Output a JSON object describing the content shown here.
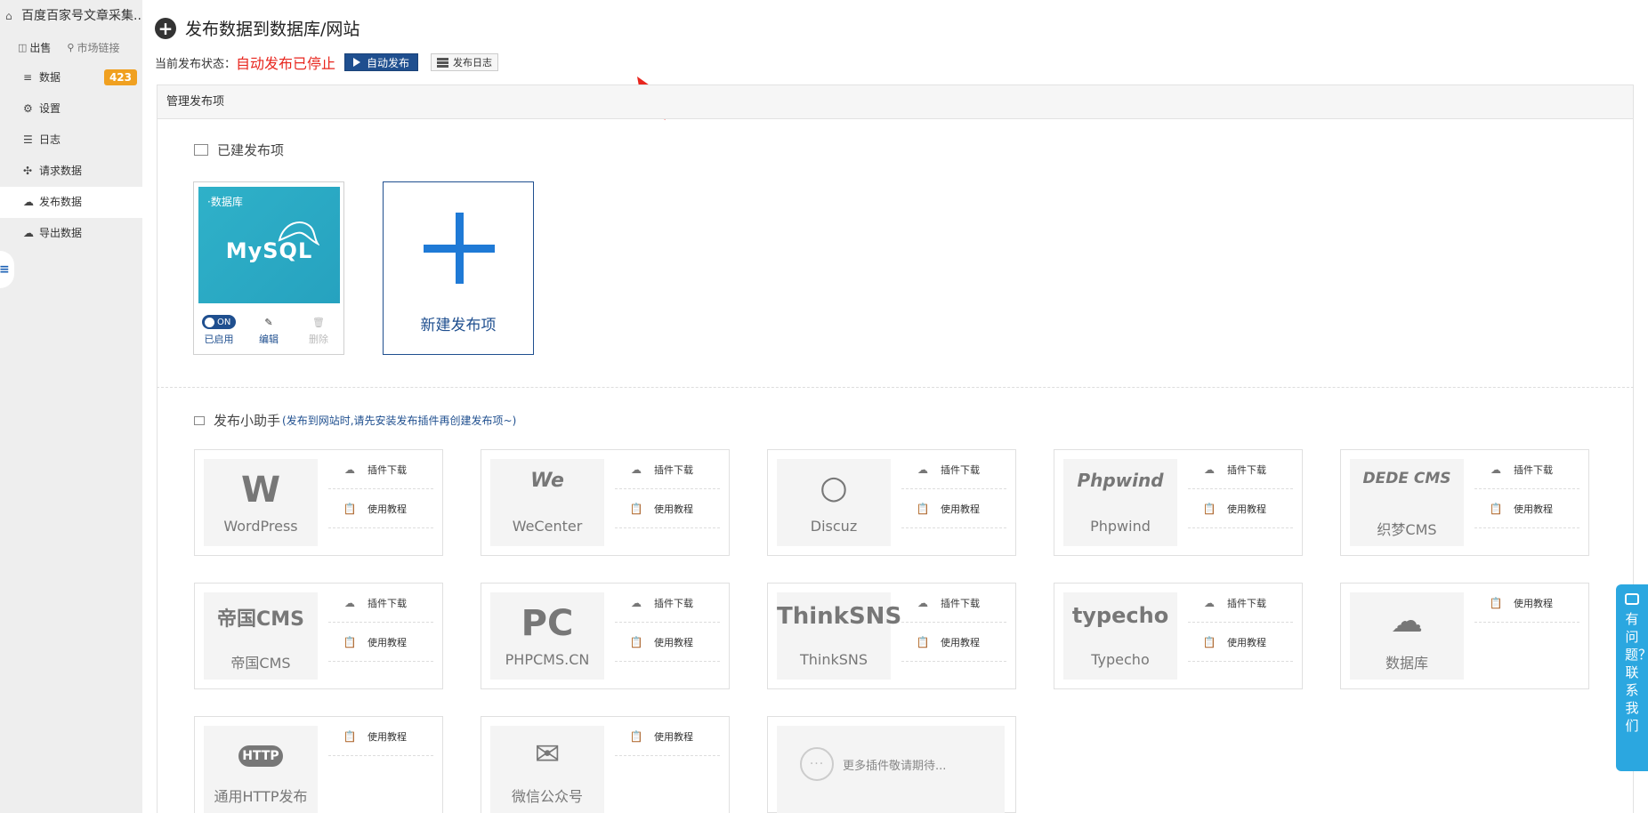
{
  "sidebar": {
    "title": "百度百家号文章采集...",
    "links": [
      "出售",
      "市场链接"
    ],
    "items": [
      {
        "label": "数据",
        "badge": "423"
      },
      {
        "label": "设置"
      },
      {
        "label": "日志"
      },
      {
        "label": "请求数据"
      },
      {
        "label": "发布数据"
      },
      {
        "label": "导出数据"
      }
    ]
  },
  "header": {
    "title": "发布数据到数据库/网站",
    "status_label": "当前发布状态：",
    "status_value": "自动发布已停止",
    "auto_button": "自动发布",
    "log_button": "发布日志"
  },
  "panel": {
    "title": "管理发布项",
    "built_title": "已建发布项",
    "db_card": {
      "tag": "·数据库",
      "logo": "MySQL",
      "toggle": "ON",
      "enabled": "已启用",
      "edit": "编辑",
      "delete": "删除"
    },
    "new_label": "新建发布项",
    "helper_title": "发布小助手",
    "helper_note": "(发布到网站时,请先安装发布插件再创建发布项~)",
    "opt_download": "插件下载",
    "opt_tutorial": "使用教程",
    "plugins": [
      {
        "name": "WordPress",
        "mark": "W"
      },
      {
        "name": "WeCenter",
        "mark": "We"
      },
      {
        "name": "Discuz",
        "mark": "○"
      },
      {
        "name": "Phpwind",
        "mark": "Phpwind"
      },
      {
        "name": "织梦CMS",
        "mark": "DEDE CMS"
      },
      {
        "name": "帝国CMS",
        "mark": "帝国CMS"
      },
      {
        "name": "PHPCMS.CN",
        "mark": "PC"
      },
      {
        "name": "ThinkSNS",
        "mark": "ThinkSNS"
      },
      {
        "name": "Typecho",
        "mark": "typecho"
      },
      {
        "name": "数据库",
        "mark": "☁"
      },
      {
        "name": "通用HTTP发布",
        "mark": "HTTP"
      },
      {
        "name": "微信公众号",
        "mark": "✉"
      }
    ],
    "more_label": "更多插件敬请期待..."
  },
  "contact": {
    "text": "有问题？联系我们"
  },
  "colors": {
    "primary": "#1f4f8f",
    "danger": "#e8261e",
    "badge": "#f0a020",
    "contact": "#2ba7e0"
  }
}
